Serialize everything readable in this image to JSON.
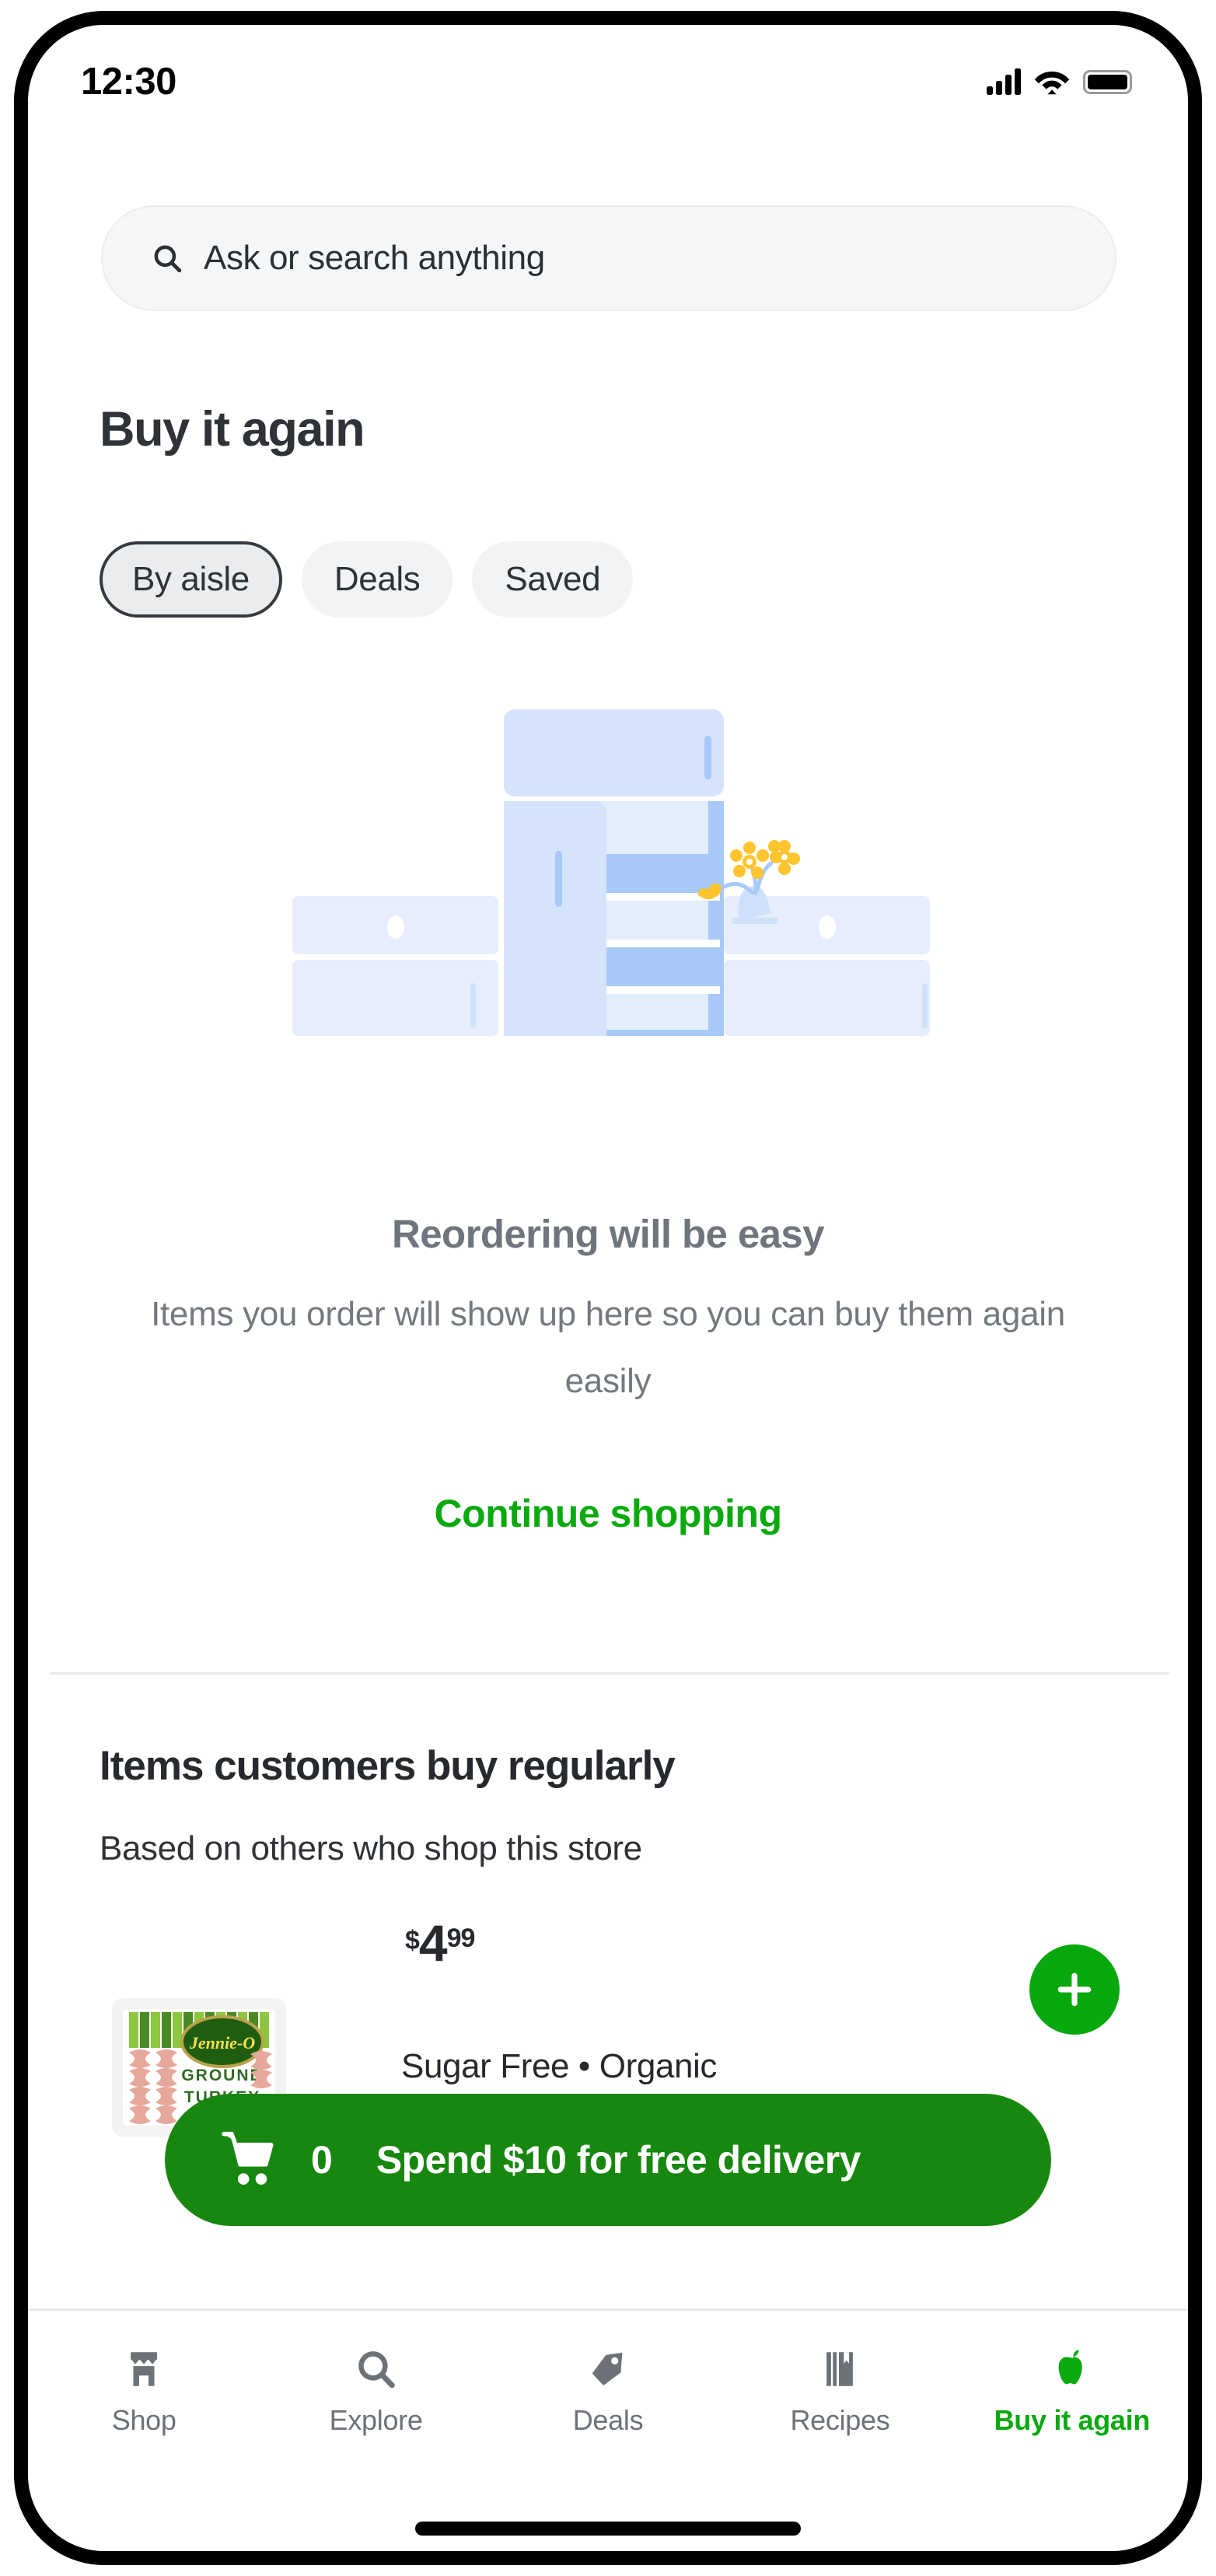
{
  "status_bar": {
    "time": "12:30",
    "signal_icon": "cellular-signal-icon",
    "wifi_icon": "wifi-icon",
    "battery_icon": "battery-full-icon"
  },
  "search": {
    "placeholder": "Ask or search anything",
    "value": "",
    "icon": "search-icon"
  },
  "header": {
    "title": "Buy it again"
  },
  "filter_chips": [
    {
      "label": "By aisle",
      "selected": true
    },
    {
      "label": "Deals",
      "selected": false
    },
    {
      "label": "Saved",
      "selected": false
    }
  ],
  "empty_state": {
    "illustration": "kitchen-fridge-illustration",
    "title": "Reordering will be easy",
    "body": "Items you order will show up here so you can buy them again easily",
    "cta_label": "Continue shopping"
  },
  "recommendations": {
    "title": "Items customers buy regularly",
    "subtitle": "Based on others who shop this store",
    "product": {
      "image_alt": "Jennie-O Ground Turkey package",
      "brand": "Jennie-O",
      "pack_line1": "GROUND",
      "pack_line2": "TURKEY",
      "price_currency": "$",
      "price_whole": "4",
      "price_cents": "99",
      "attributes": "Sugar Free • Organic",
      "add_label": "+"
    }
  },
  "cart_banner": {
    "icon": "shopping-cart-icon",
    "count": "0",
    "message": "Spend $10 for free delivery"
  },
  "bottom_nav": [
    {
      "label": "Shop",
      "icon": "storefront-icon",
      "active": false
    },
    {
      "label": "Explore",
      "icon": "search-icon",
      "active": false
    },
    {
      "label": "Deals",
      "icon": "price-tag-icon",
      "active": false
    },
    {
      "label": "Recipes",
      "icon": "recipe-book-icon",
      "active": false
    },
    {
      "label": "Buy it again",
      "icon": "apple-icon",
      "active": true
    }
  ],
  "colors": {
    "brand_green": "#0aaa0f",
    "cart_green": "#17870f",
    "text_dark": "#26292d",
    "text_muted": "#6e757c",
    "chip_bg": "#f2f3f5",
    "illustration_blue": "#cfe0fb",
    "illustration_accent": "#ffc42e"
  }
}
